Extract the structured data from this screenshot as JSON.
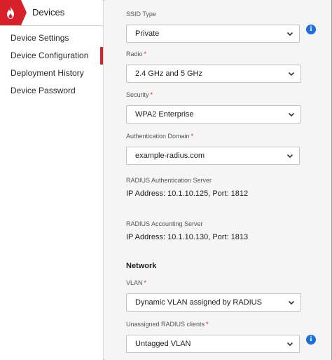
{
  "sidebar": {
    "title": "Devices",
    "items": [
      {
        "label": "Device Settings"
      },
      {
        "label": "Device Configuration",
        "active": true
      },
      {
        "label": "Deployment History"
      },
      {
        "label": "Device Password"
      }
    ]
  },
  "form": {
    "ssid_type": {
      "label": "SSID Type",
      "value": "Private"
    },
    "radio": {
      "label": "Radio",
      "required": "*",
      "value": "2.4 GHz and 5 GHz"
    },
    "security": {
      "label": "Security",
      "required": "*",
      "value": "WPA2 Enterprise"
    },
    "auth_domain": {
      "label": "Authentication Domain",
      "required": "*",
      "value": "example-radius.com"
    },
    "radius_auth_server": {
      "label": "RADIUS Authentication Server",
      "value": "IP Address: 10.1.10.125, Port: 1812"
    },
    "radius_acct_server": {
      "label": "RADIUS Accounting Server",
      "value": "IP Address: 10.1.10.130, Port: 1813"
    },
    "network_heading": "Network",
    "vlan": {
      "label": "VLAN",
      "required": "*",
      "value": "Dynamic VLAN assigned by RADIUS"
    },
    "unassigned_clients": {
      "label": "Unassigned RADIUS clients",
      "required": "*",
      "value": "Untagged VLAN"
    }
  },
  "icons": {
    "brand": "flame-icon",
    "chevron": "chevron-down-icon",
    "info": "info-icon"
  },
  "colors": {
    "brand_red": "#d8202a",
    "info_blue": "#1e6fd9",
    "panel_bg": "#f5f5f5"
  }
}
